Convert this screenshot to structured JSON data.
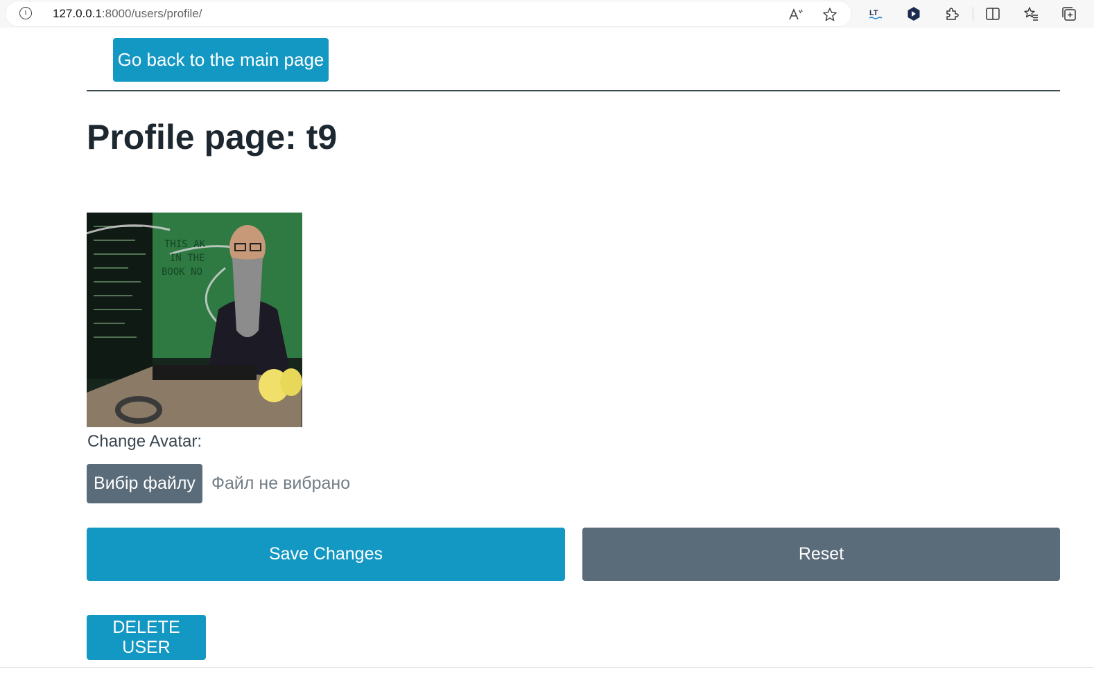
{
  "browser": {
    "url_host": "127.0.0.1",
    "url_rest": ":8000/users/profile/",
    "toolbar_icons": [
      "read-aloud-icon",
      "favorite-star-icon",
      "languagetool-extension-icon",
      "hexagon-extension-icon",
      "extensions-puzzle-icon",
      "split-screen-icon",
      "favorites-list-icon",
      "collections-icon"
    ]
  },
  "page": {
    "back_button_label": "Go back to the main page",
    "title": "Profile page: t9",
    "avatar_alt": "User avatar",
    "change_avatar_label": "Change Avatar:",
    "file_button_label": "Вибір файлу",
    "file_status": "Файл не вибрано",
    "save_label": "Save Changes",
    "reset_label": "Reset",
    "delete_label": "DELETE USER"
  },
  "colors": {
    "primary_info": "#1397c3",
    "secondary": "#5a6b7a",
    "heading": "#1d2730"
  }
}
